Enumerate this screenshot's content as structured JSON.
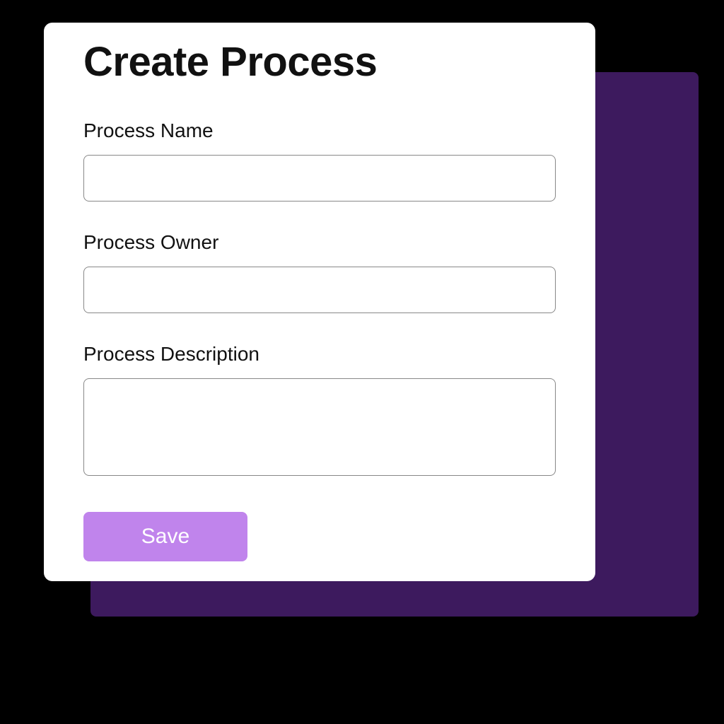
{
  "modal": {
    "title": "Create Process",
    "fields": {
      "name": {
        "label": "Process Name",
        "value": ""
      },
      "owner": {
        "label": "Process Owner",
        "value": ""
      },
      "description": {
        "label": "Process Description",
        "value": ""
      }
    },
    "save_label": "Save"
  }
}
